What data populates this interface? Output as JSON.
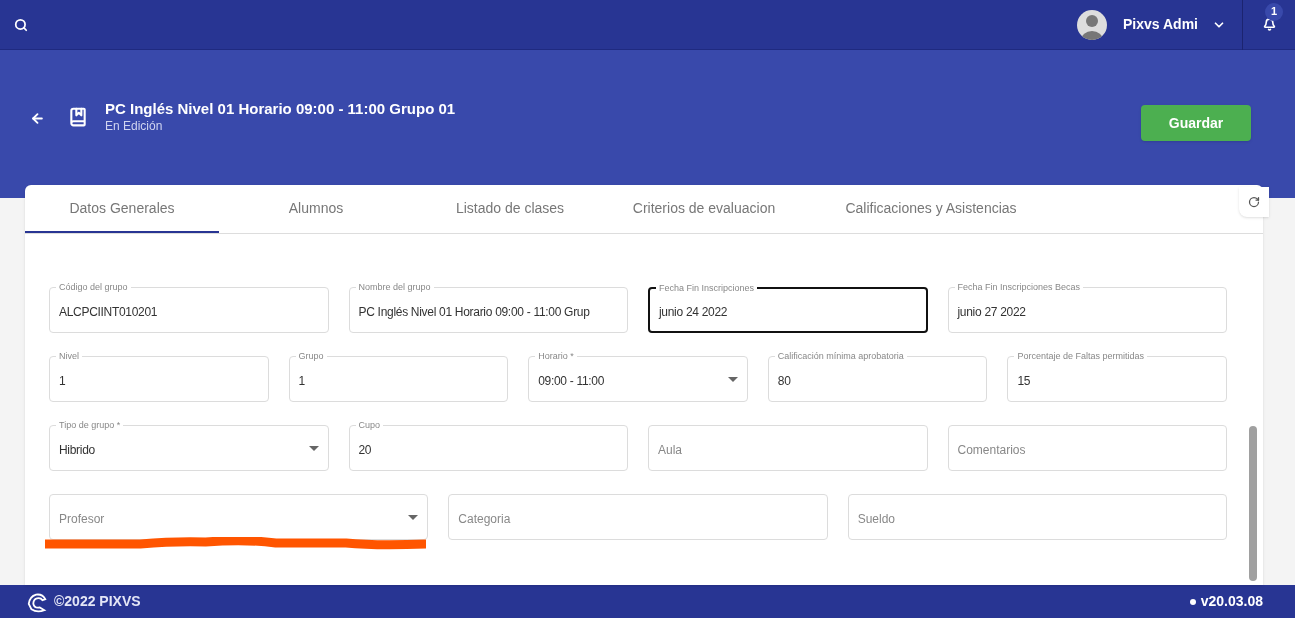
{
  "topbar": {
    "user": "Pixvs Admi",
    "notifications": "1"
  },
  "header": {
    "title": "PC Inglés Nivel 01 Horario 09:00 - 11:00 Grupo 01",
    "subtitle": "En Edición",
    "save_button": "Guardar"
  },
  "tabs": [
    {
      "label": "Datos Generales",
      "selected": true
    },
    {
      "label": "Alumnos",
      "selected": false
    },
    {
      "label": "Listado de clases",
      "selected": false
    },
    {
      "label": "Criterios de evaluacion",
      "selected": false
    },
    {
      "label": "Calificaciones y Asistencias",
      "selected": false
    }
  ],
  "form_rows": [
    [
      {
        "kind": "text",
        "label": "Código del grupo",
        "value": "ALCPCIINT010201",
        "focused": false
      },
      {
        "kind": "text",
        "label": "Nombre del grupo",
        "value": "PC  Inglés Nivel 01 Horario 09:00 - 11:00 Grup",
        "focused": false
      },
      {
        "kind": "text",
        "label": "Fecha Fin Inscripciones",
        "value": "junio 24 2022",
        "focused": true
      },
      {
        "kind": "text",
        "label": "Fecha Fin Inscripciones Becas",
        "value": "junio 27 2022",
        "focused": false
      }
    ],
    [
      {
        "kind": "text",
        "label": "Nivel",
        "value": "1",
        "focused": false
      },
      {
        "kind": "text",
        "label": "Grupo",
        "value": "1",
        "focused": false
      },
      {
        "kind": "select",
        "label": "Horario *",
        "value": "09:00 - 11:00",
        "focused": false
      },
      {
        "kind": "text",
        "label": "Calificación mínima aprobatoria",
        "value": "80",
        "focused": false
      },
      {
        "kind": "text",
        "label": "Porcentaje de Faltas permitidas",
        "value": "15",
        "focused": false
      }
    ],
    [
      {
        "kind": "select",
        "label": "Tipo de grupo *",
        "value": "Hibrido",
        "focused": false
      },
      {
        "kind": "text",
        "label": "Cupo",
        "value": "20",
        "focused": false
      },
      {
        "kind": "text",
        "placeholder": "Aula",
        "focused": false
      },
      {
        "kind": "text",
        "placeholder": "Comentarios",
        "focused": false
      }
    ],
    [
      {
        "kind": "select",
        "placeholder": "Profesor",
        "focused": false,
        "marked": true
      },
      {
        "kind": "text",
        "placeholder": "Categoria",
        "focused": false,
        "marked": false
      },
      {
        "kind": "text",
        "placeholder": "Sueldo",
        "focused": false,
        "marked": false
      }
    ]
  ],
  "footer": {
    "copyright": "©2022 PIXVS",
    "version": "v20.03.08"
  }
}
